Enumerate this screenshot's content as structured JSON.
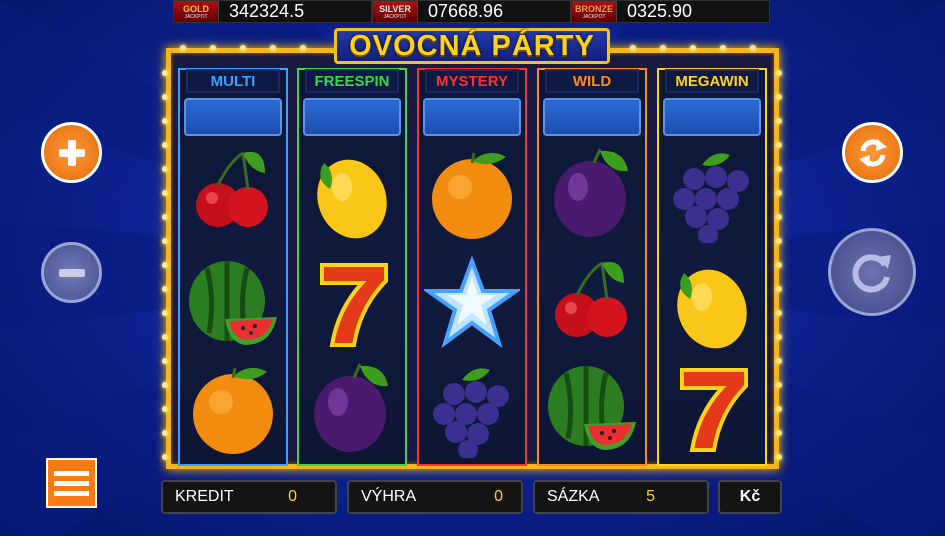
{
  "jackpots": [
    {
      "name": "GOLD",
      "sub": "JACKPOT",
      "value": "342324.5"
    },
    {
      "name": "SILVER",
      "sub": "JACKPOT",
      "value": "07668.96"
    },
    {
      "name": "BRONZE",
      "sub": "JACKPOT",
      "value": "0325.90"
    }
  ],
  "title": "OVOCNÁ PÁRTY",
  "reels": [
    {
      "label": "MULTI",
      "color": "#3aa0ff",
      "symbols": [
        "cherry",
        "watermelon",
        "orange"
      ]
    },
    {
      "label": "FREESPIN",
      "color": "#39d64a",
      "symbols": [
        "lemon",
        "seven",
        "plum"
      ]
    },
    {
      "label": "MYSTERY",
      "color": "#ff3030",
      "symbols": [
        "orange",
        "star",
        "grapes"
      ]
    },
    {
      "label": "WILD",
      "color": "#ff8a1a",
      "symbols": [
        "plum",
        "cherry",
        "watermelon"
      ]
    },
    {
      "label": "MEGAWIN",
      "color": "#ffd21a",
      "symbols": [
        "grapes",
        "lemon",
        "seven"
      ]
    }
  ],
  "bottom": {
    "credit_label": "KREDIT",
    "credit_value": "0",
    "win_label": "VÝHRA",
    "win_value": "0",
    "bet_label": "SÁZKA",
    "bet_value": "5",
    "currency": "Kč"
  },
  "controls": [
    "plus-icon",
    "minus-icon",
    "autoplay-icon",
    "spin-icon",
    "menu-icon"
  ]
}
